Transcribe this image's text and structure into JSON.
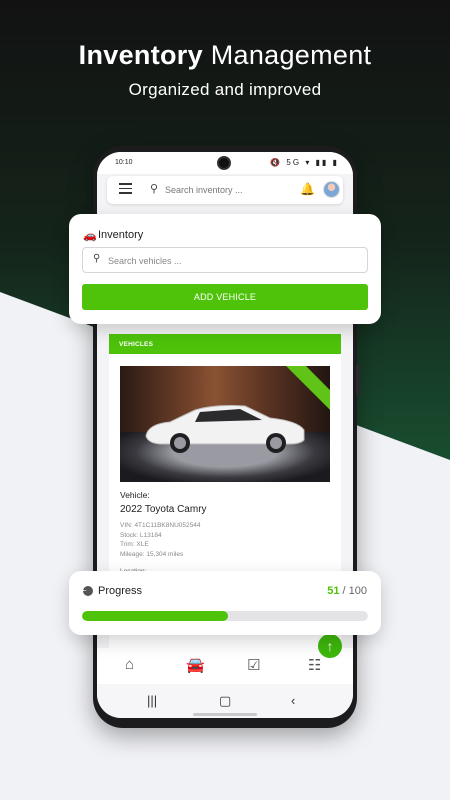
{
  "hero": {
    "title_bold": "Inventory",
    "title_rest": "Management",
    "subtitle": "Organized and improved"
  },
  "status_bar": {
    "time": "10:10",
    "icons": "🔇 5G ▾ ▮▮ ▮"
  },
  "top_bar": {
    "search_placeholder": "Search inventory ..."
  },
  "inventory_card": {
    "title": "Inventory",
    "search_placeholder": "Search vehicles ...",
    "add_button": "ADD VEHICLE"
  },
  "vehicles": {
    "header": "VEHICLES",
    "label": "Vehicle:",
    "name": "2022 Toyota Camry",
    "vin": "VIN: 4T1C11BK8NU052544",
    "stock": "Stock: L13184",
    "trim": "Trim: XLE",
    "mileage": "Mileage: 15,304 miles",
    "location": "Location:"
  },
  "progress": {
    "label": "Progress",
    "done": "51",
    "total": "/ 100",
    "fraction": 0.51
  },
  "colors": {
    "accent": "#4ec30a",
    "dark_bg": "#121212",
    "green_bg": "#1a5633"
  },
  "icons": [
    "menu-icon",
    "search-icon",
    "bell-icon",
    "avatar",
    "car-icon",
    "pie-icon",
    "home-icon",
    "car-nav-icon",
    "checkbox-icon",
    "qr-scan-icon",
    "arrow-up-icon"
  ]
}
